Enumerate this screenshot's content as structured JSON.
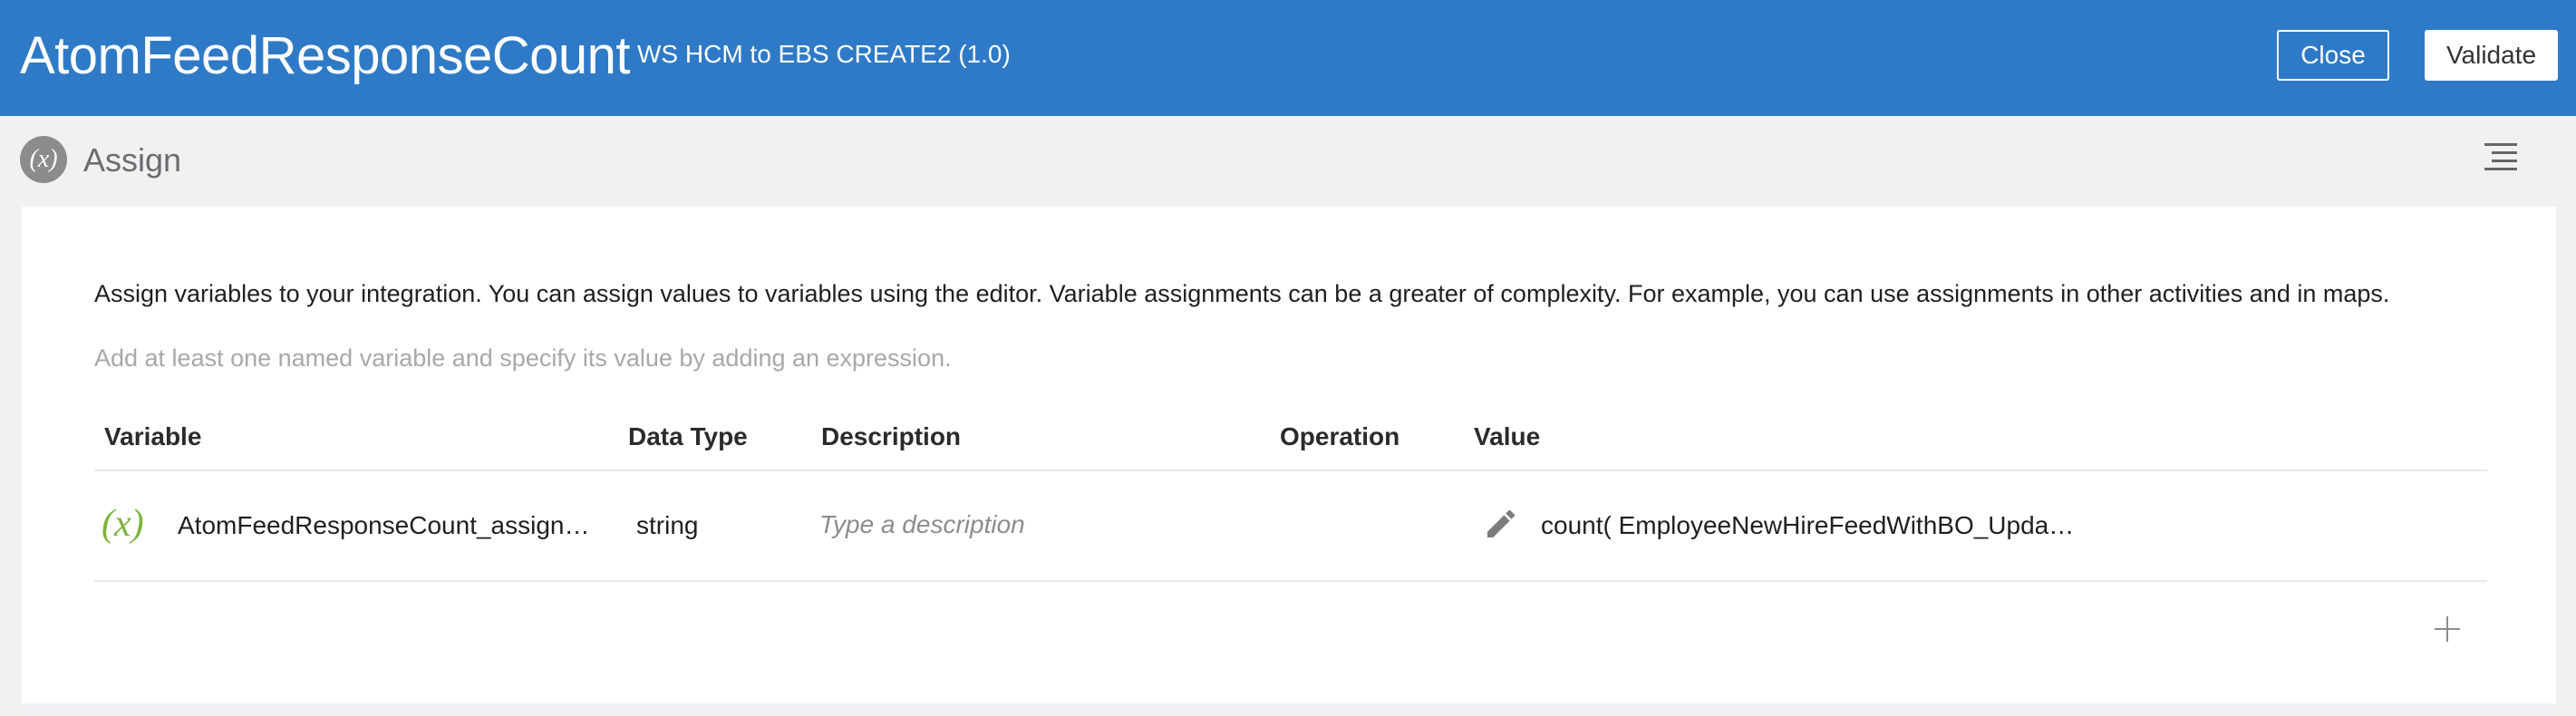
{
  "header": {
    "title": "AtomFeedResponseCount",
    "subtitle": "WS HCM to EBS CREATE2 (1.0)",
    "close_label": "Close",
    "validate_label": "Validate"
  },
  "section": {
    "icon_text": "(x)",
    "title": "Assign"
  },
  "card": {
    "intro": "Assign variables to your integration. You can assign values to variables using the editor. Variable assignments can be a greater of complexity. For example, you can use assignments in other activities and in maps.",
    "hint": "Add at least one named variable and specify its value by adding an expression."
  },
  "table": {
    "headers": {
      "variable": "Variable",
      "data_type": "Data Type",
      "description": "Description",
      "operation": "Operation",
      "value": "Value"
    },
    "rows": [
      {
        "icon_text": "(x)",
        "variable": "AtomFeedResponseCount_assign…",
        "data_type": "string",
        "description_placeholder": "Type a description",
        "description_value": "",
        "operation": "",
        "value": "count( EmployeeNewHireFeedWithBO_Upda…"
      }
    ]
  },
  "icons": {
    "menu": "hamburger-icon",
    "edit": "pencil-icon",
    "add": "plus-icon",
    "variable": "variable-icon"
  },
  "colors": {
    "header_bg": "#2f7ac6",
    "page_bg": "#eff1f3",
    "variable_icon": "#7fb33d",
    "hint_text": "#a6a8aa"
  }
}
